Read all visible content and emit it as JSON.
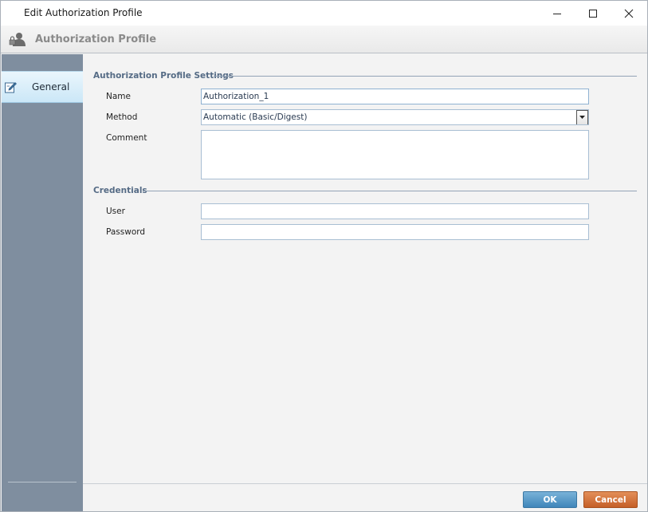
{
  "window": {
    "title": "Edit Authorization Profile"
  },
  "header": {
    "title": "Authorization Profile",
    "icon": "user-lock-icon"
  },
  "sidebar": {
    "items": [
      {
        "label": "General",
        "icon": "edit-icon",
        "selected": true
      }
    ]
  },
  "sections": {
    "settings": {
      "title": "Authorization Profile Settings",
      "name_label": "Name",
      "name_value": "Authorization_1",
      "method_label": "Method",
      "method_value": "Automatic (Basic/Digest)",
      "comment_label": "Comment",
      "comment_value": ""
    },
    "credentials": {
      "title": "Credentials",
      "user_label": "User",
      "user_value": "",
      "password_label": "Password",
      "password_value": ""
    }
  },
  "footer": {
    "ok_label": "OK",
    "cancel_label": "Cancel"
  },
  "colors": {
    "sidebar": "#7f8e9f",
    "ok_button": "#3f86ba",
    "cancel_button": "#c55f27",
    "section_title": "#556b85"
  }
}
